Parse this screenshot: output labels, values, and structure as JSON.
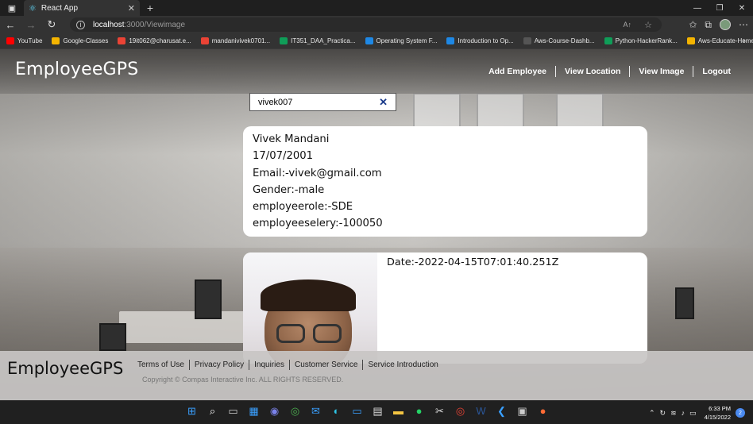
{
  "browser": {
    "tab_title": "React App",
    "url_host": "localhost",
    "url_path": ":3000/Viewimage",
    "bookmarks": [
      {
        "label": "YouTube",
        "color": "#ff0000"
      },
      {
        "label": "Google-Classes",
        "color": "#f4b400"
      },
      {
        "label": "19it062@charusat.e...",
        "color": "#ea4335"
      },
      {
        "label": "mandanivivek0701...",
        "color": "#ea4335"
      },
      {
        "label": "IT351_DAA_Practica...",
        "color": "#0f9d58"
      },
      {
        "label": "Operating System F...",
        "color": "#1e88e5"
      },
      {
        "label": "Introduction to Op...",
        "color": "#1e88e5"
      },
      {
        "label": "Aws-Course-Dashb...",
        "color": "#555555"
      },
      {
        "label": "Python-HackerRank...",
        "color": "#0f9d58"
      },
      {
        "label": "Aws-Educate-Home",
        "color": "#f4b400"
      }
    ]
  },
  "header": {
    "brand": "EmployeeGPS",
    "nav": [
      "Add Employee",
      "View Location",
      "View Image",
      "Logout"
    ]
  },
  "search": {
    "value": "vivek007"
  },
  "employee": {
    "name": "Vivek Mandani",
    "dob": "17/07/2001",
    "email": "Email:-vivek@gmail.com",
    "gender": "Gender:-male",
    "role": "employeerole:-SDE",
    "salary": "employeeselery:-100050"
  },
  "image_card": {
    "date": "Date:-2022-04-15T07:01:40.251Z"
  },
  "footer": {
    "brand": "EmployeeGPS",
    "links": [
      "Terms of Use",
      "Privacy Policy",
      "Inquiries",
      "Customer Service",
      "Service Introduction"
    ],
    "copyright": "Copyright © Compas Interactive Inc. ALL RIGHTS RESERVED."
  },
  "taskbar": {
    "time": "6:33 PM",
    "date": "4/15/2022",
    "notifications": "2"
  }
}
